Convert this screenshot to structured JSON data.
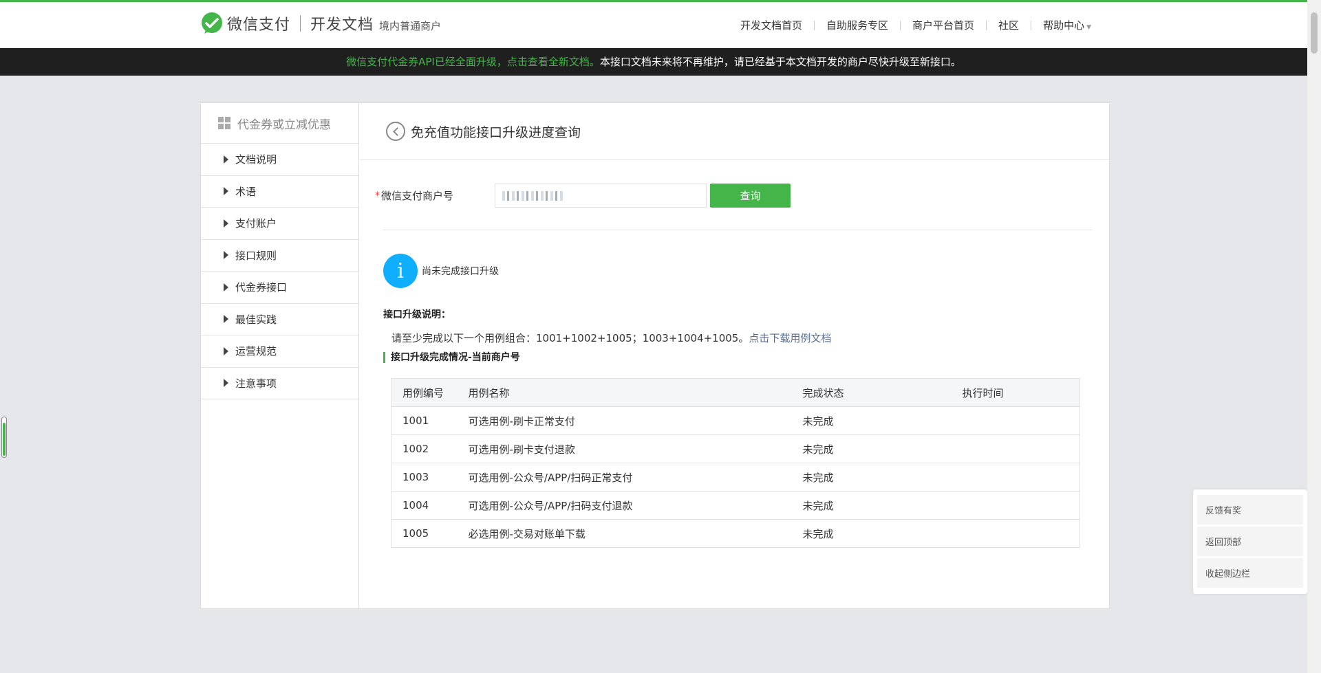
{
  "header": {
    "brand": "微信支付",
    "doc_title": "开发文档",
    "doc_sub": "境内普通商户",
    "nav": [
      "开发文档首页",
      "自助服务专区",
      "商户平台首页",
      "社区",
      "帮助中心"
    ]
  },
  "banner": {
    "highlight": "微信支付代金券API已经全面升级，点击查看全新文档。",
    "rest": "本接口文档未来将不再维护，请已经基于本文档开发的商户尽快升级至新接口。"
  },
  "sidebar": {
    "title": "代金券或立减优惠",
    "items": [
      "文档说明",
      "术语",
      "支付账户",
      "接口规则",
      "代金券接口",
      "最佳实践",
      "运营规范",
      "注意事项"
    ]
  },
  "page": {
    "title": "免充值功能接口升级进度查询",
    "form_label": "微信支付商户号",
    "required_mark": "*",
    "query_button": "查询",
    "status": "尚未完成接口升级",
    "upgrade_title": "接口升级说明：",
    "upgrade_desc": "请至少完成以下一个用例组合：1001+1002+1005；1003+1004+1005。",
    "upgrade_link": "点击下载用例文档",
    "section_title": "接口升级完成情况-当前商户号"
  },
  "table": {
    "headers": [
      "用例编号",
      "用例名称",
      "完成状态",
      "执行时间"
    ],
    "rows": [
      [
        "1001",
        "可选用例-刷卡正常支付",
        "未完成",
        ""
      ],
      [
        "1002",
        "可选用例-刷卡支付退款",
        "未完成",
        ""
      ],
      [
        "1003",
        "可选用例-公众号/APP/扫码正常支付",
        "未完成",
        ""
      ],
      [
        "1004",
        "可选用例-公众号/APP/扫码支付退款",
        "未完成",
        ""
      ],
      [
        "1005",
        "必选用例-交易对账单下载",
        "未完成",
        ""
      ]
    ]
  },
  "float_panel": [
    "反馈有奖",
    "返回顶部",
    "收起侧边栏"
  ],
  "colors": {
    "brand_green": "#44b549",
    "info_blue": "#10aeff",
    "link": "#576b95"
  },
  "icons": [
    "wechat-logo-icon",
    "grid-icon",
    "triangle-right-icon",
    "back-circle-icon",
    "info-icon",
    "caret-down-icon"
  ]
}
